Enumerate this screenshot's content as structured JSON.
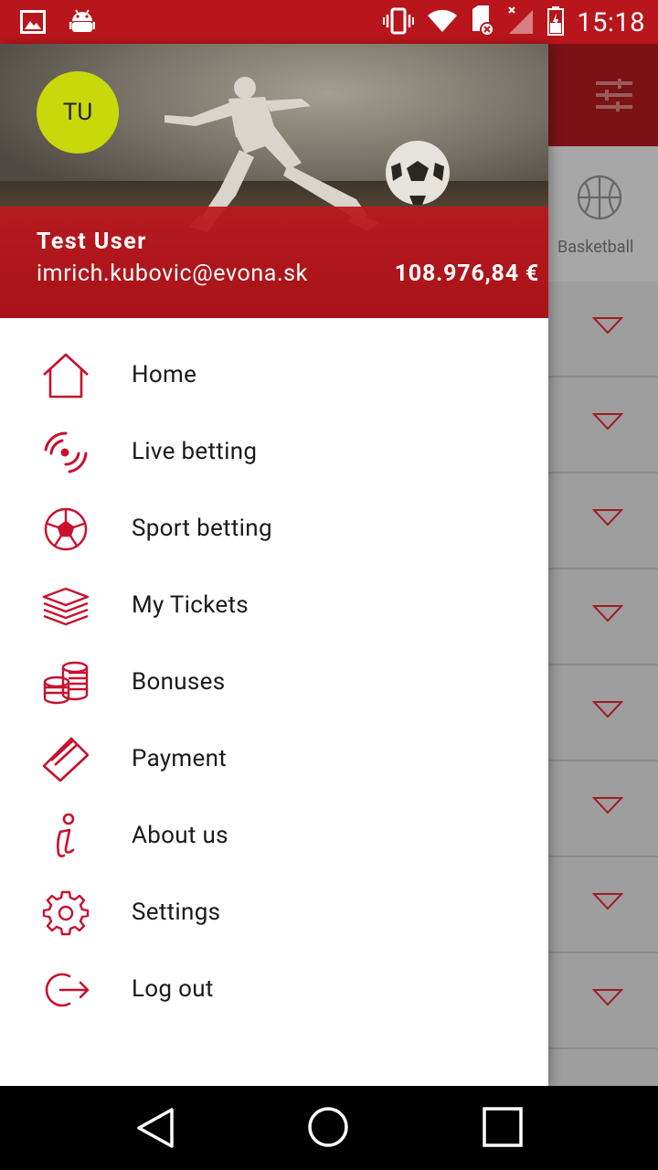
{
  "status_bar": {
    "time": "15:18"
  },
  "background_app": {
    "tab_label": "Basketball",
    "row_count": 8
  },
  "drawer": {
    "avatar_initials": "TU",
    "user_name": "Test User",
    "user_email": "imrich.kubovic@evona.sk",
    "balance": "108.976,84 €",
    "menu": [
      {
        "label": "Home",
        "icon": "home-icon"
      },
      {
        "label": "Live betting",
        "icon": "live-signal-icon"
      },
      {
        "label": "Sport betting",
        "icon": "soccer-ball-icon"
      },
      {
        "label": "My Tickets",
        "icon": "tickets-stack-icon"
      },
      {
        "label": "Bonuses",
        "icon": "coins-icon"
      },
      {
        "label": "Payment",
        "icon": "credit-card-icon"
      },
      {
        "label": "About us",
        "icon": "info-icon"
      },
      {
        "label": "Settings",
        "icon": "gear-icon"
      },
      {
        "label": "Log out",
        "icon": "logout-icon"
      }
    ]
  },
  "colors": {
    "accent": "#c8102e",
    "status_bar": "#b8161c",
    "avatar": "#c9d80a"
  }
}
